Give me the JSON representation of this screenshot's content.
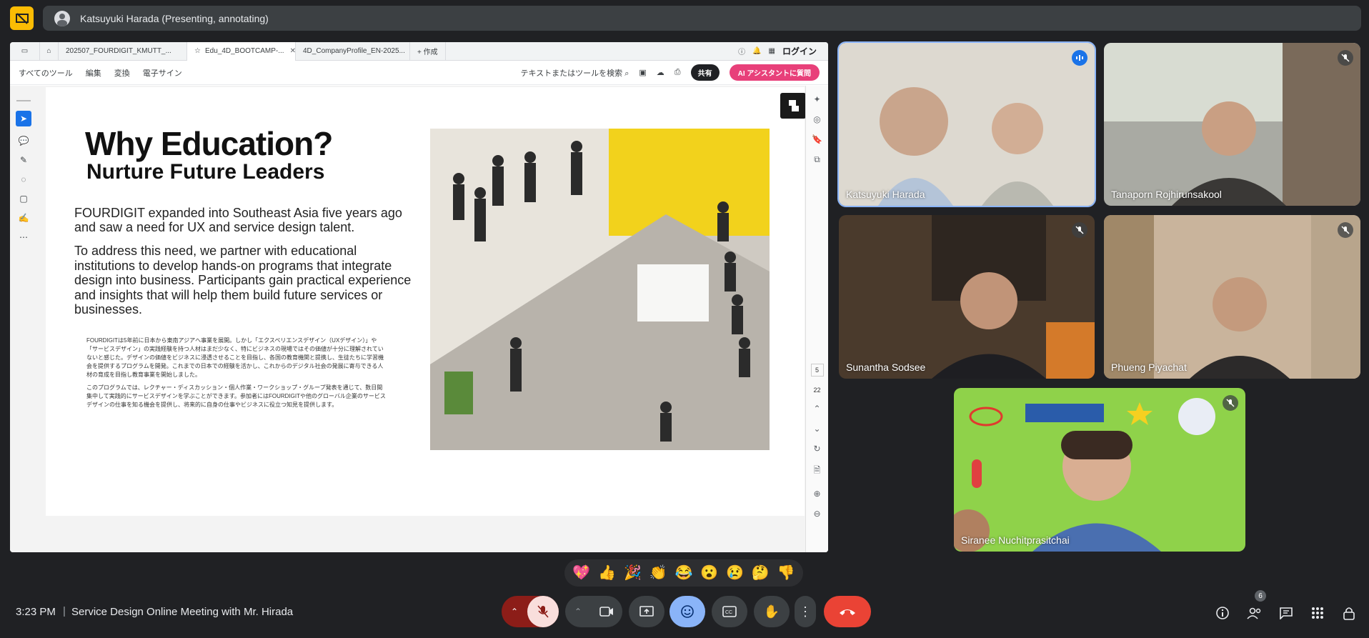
{
  "presenter": {
    "label": "Katsuyuki Harada (Presenting, annotating)"
  },
  "browser": {
    "tabs": [
      {
        "label": "202507_FOURDIGIT_KMUTT_..."
      },
      {
        "label": "Edu_4D_BOOTCAMP-..."
      },
      {
        "label": "4D_CompanyProfile_EN-2025..."
      }
    ],
    "new_tab_label": "+ 作成",
    "login_label": "ログイン"
  },
  "pdf_toolbar": {
    "menus": [
      "すべてのツール",
      "編集",
      "変換",
      "電子サイン"
    ],
    "search_label": "テキストまたはツールを検索",
    "share_label": "共有",
    "ai_label": "AI アシスタントに質問"
  },
  "page_nav": {
    "current": "5",
    "total": "22"
  },
  "slide": {
    "title": "Why Education?",
    "subtitle": "Nurture Future Leaders",
    "paragraph1": "FOURDIGIT expanded into Southeast Asia five years ago and saw a need for UX and service design talent.",
    "paragraph2": "To address this need, we partner with educational institutions to develop hands-on programs that integrate design into business. Participants gain practical experience and insights that will help them build future services or businesses.",
    "jp_paragraph1": "FOURDIGITは5年前に日本から東南アジアへ事業を展開。しかし「エクスペリエンスデザイン（UXデザイン）」や「サービスデザイン」の実践経験を持つ人材はまだ少なく、特にビジネスの現場ではその価値が十分に理解されていないと感じた。デザインの価値をビジネスに浸透させることを目指し、各国の教育機関と提携し、生徒たちに学習機会を提供するプログラムを開発。これまでの日本での経験を活かし、これからのデジタル社会の発展に寄与できる人材の育成を目指し教育事業を開始しました。",
    "jp_paragraph2": "このプログラムでは、レクチャー・ディスカッション・個人作業・ワークショップ・グループ発表を通じて、数日間集中して実践的にサービスデザインを学ぶことができます。参加者にはFOURDIGITや他のグローバル企業のサービスデザインの仕事を知る機会を提供し、将来的に自身の仕事やビジネスに役立つ知見を提供します。"
  },
  "participants": [
    {
      "name": "Katsuyuki Harada",
      "speaking": true
    },
    {
      "name": "Tanaporn Rojhirunsakool",
      "muted": true
    },
    {
      "name": "Sunantha Sodsee",
      "muted": true
    },
    {
      "name": "Phueng Piyachat",
      "muted": true
    },
    {
      "name": "Siranee Nuchitprasitchai",
      "muted": true
    }
  ],
  "reactions": [
    "💖",
    "👍",
    "🎉",
    "👏",
    "😂",
    "😮",
    "😢",
    "🤔",
    "👎"
  ],
  "footer": {
    "time": "3:23 PM",
    "separator": "|",
    "meeting_title": "Service Design Online Meeting with Mr. Hirada",
    "people_count": "6"
  },
  "colors": {
    "background": "#202124",
    "control": "#3c4043",
    "end_call": "#ea4335",
    "reaction_active": "#8ab4f8",
    "presenting_accent": "#fbbc04",
    "ai_button": "#e8407a"
  }
}
